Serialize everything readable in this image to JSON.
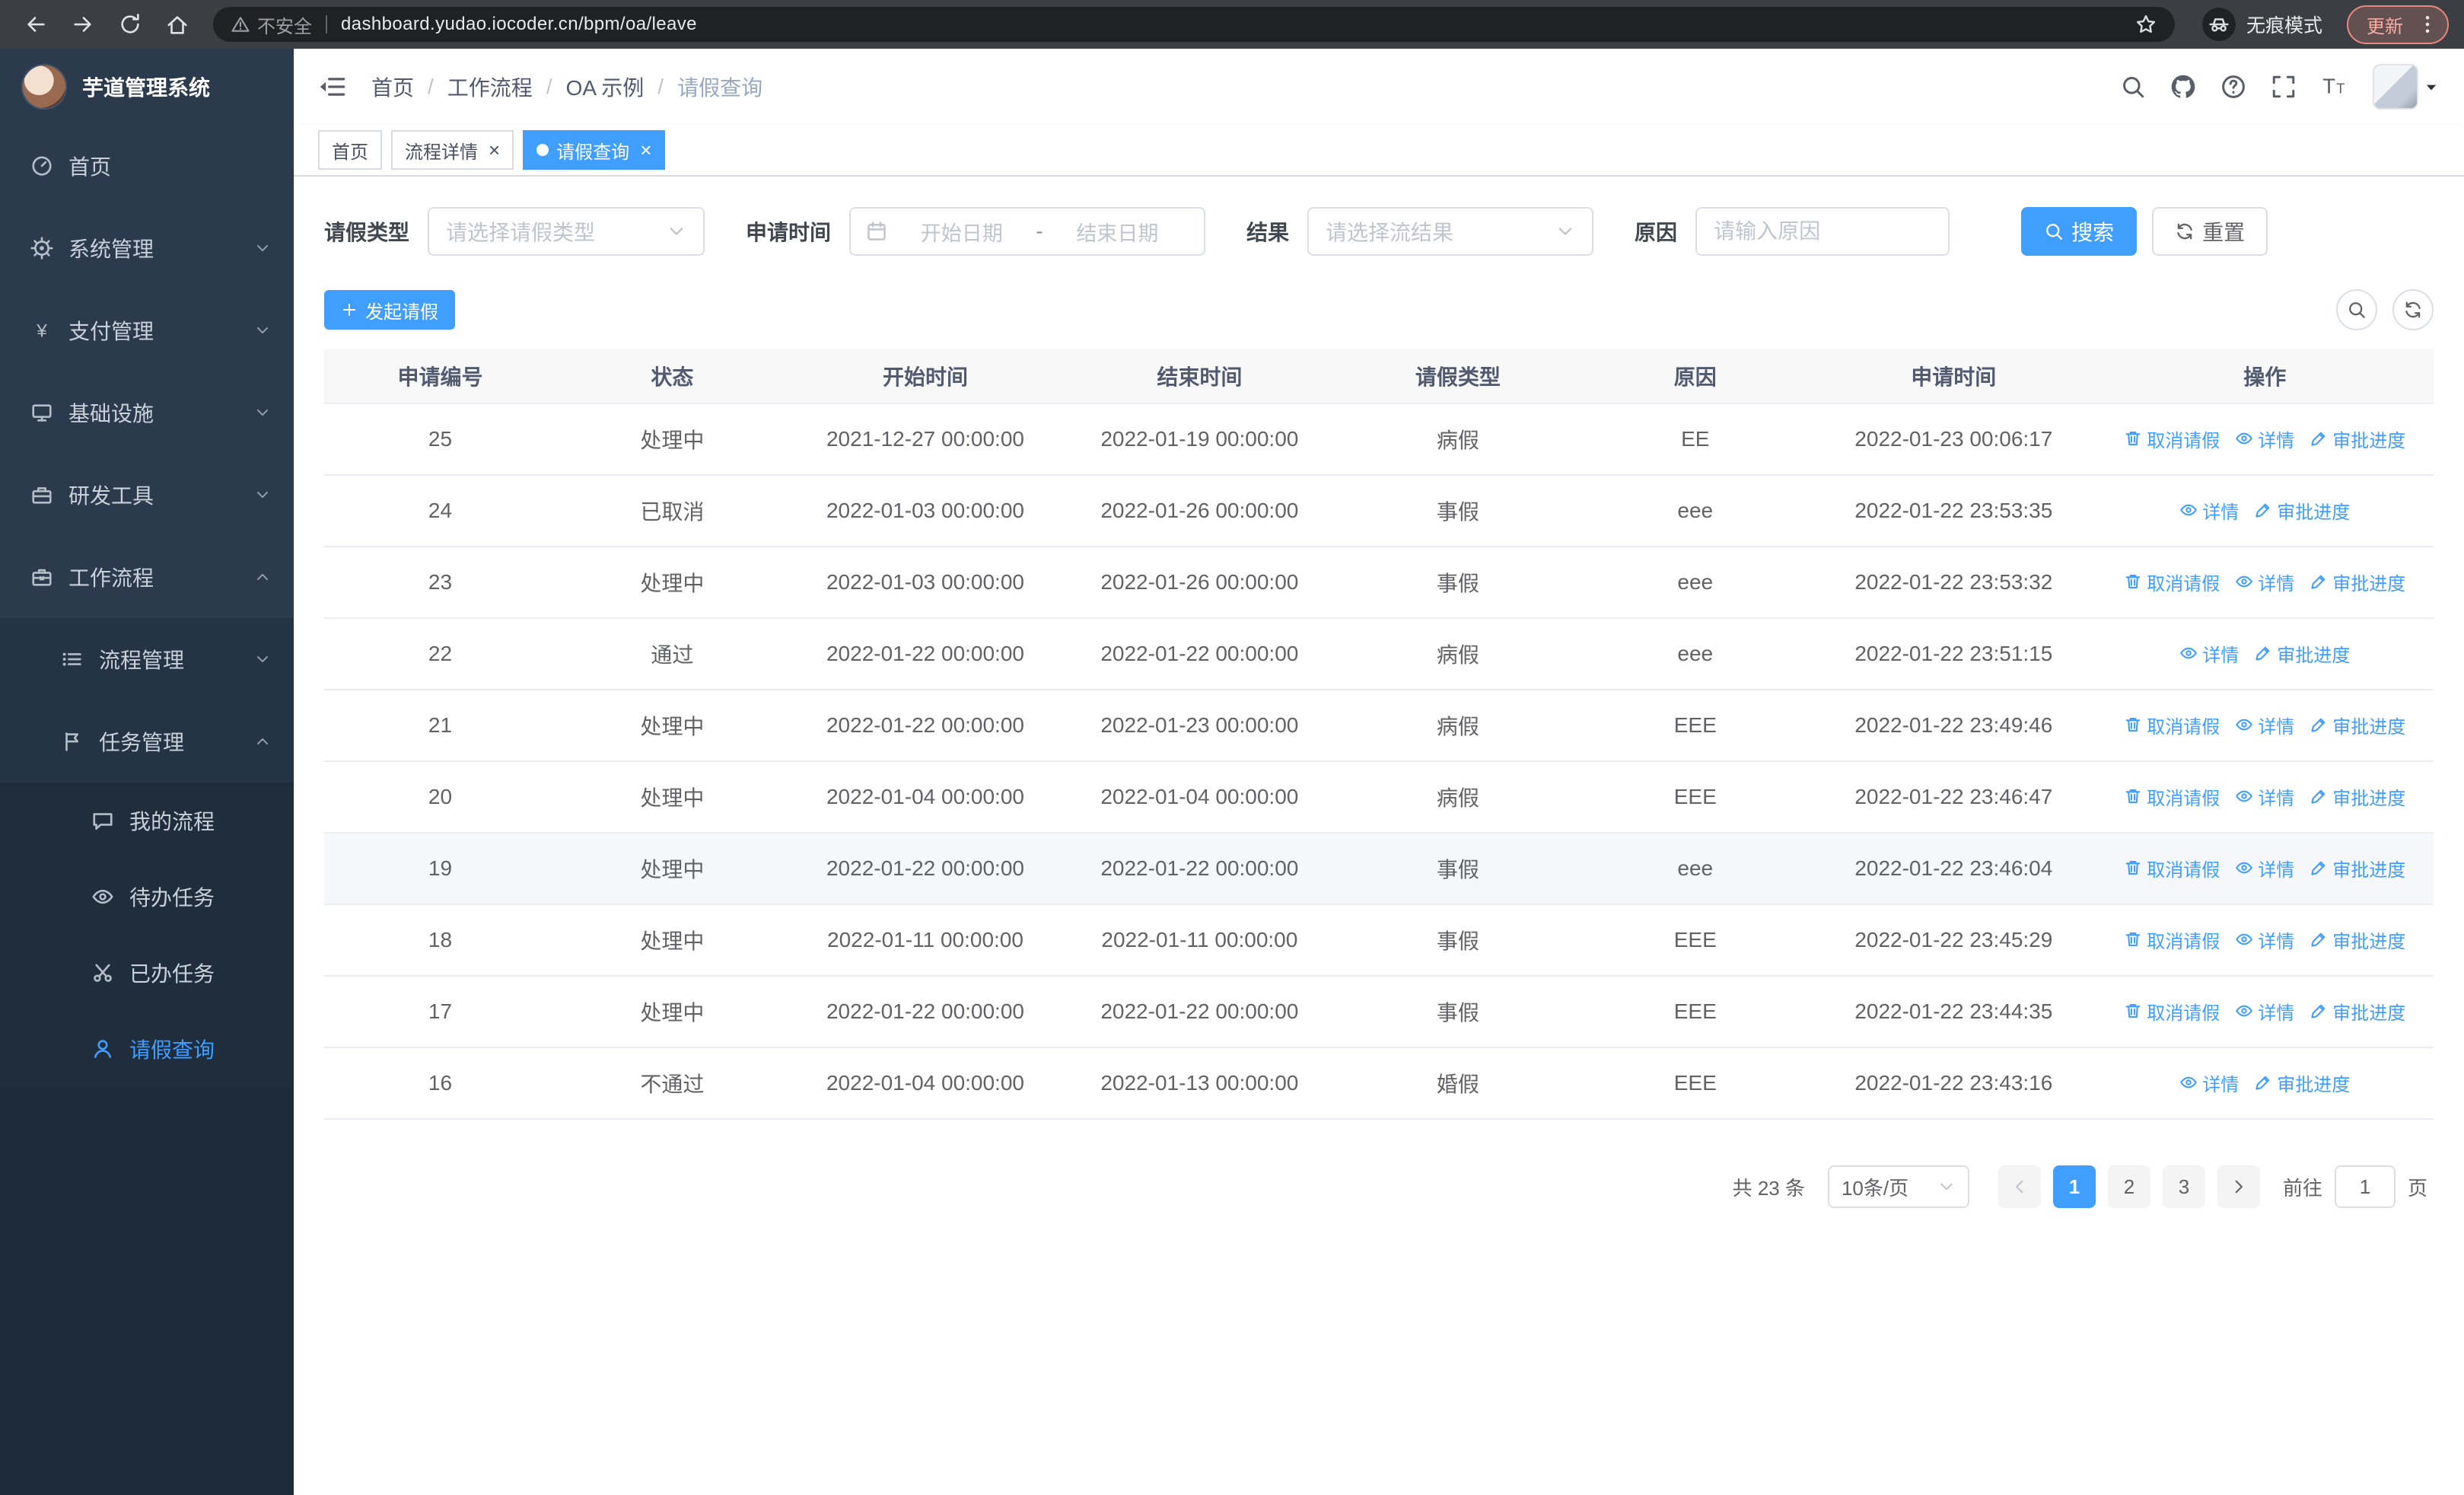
{
  "browser": {
    "security_warning": "不安全",
    "url": "dashboard.yudao.iocoder.cn/bpm/oa/leave",
    "incognito_label": "无痕模式",
    "update_label": "更新"
  },
  "sidebar": {
    "logo_title": "芋道管理系统",
    "items": [
      {
        "label": "首页",
        "icon": "dashboard",
        "level": 1
      },
      {
        "label": "系统管理",
        "icon": "gear",
        "level": 1,
        "chevron": "down"
      },
      {
        "label": "支付管理",
        "icon": "yen",
        "level": 1,
        "chevron": "down"
      },
      {
        "label": "基础设施",
        "icon": "monitor",
        "level": 1,
        "chevron": "down"
      },
      {
        "label": "研发工具",
        "icon": "toolbox",
        "level": 1,
        "chevron": "down"
      },
      {
        "label": "工作流程",
        "icon": "briefcase",
        "level": 1,
        "chevron": "up"
      },
      {
        "label": "流程管理",
        "icon": "list",
        "level": 2,
        "chevron": "down"
      },
      {
        "label": "任务管理",
        "icon": "flag",
        "level": 2,
        "chevron": "up"
      },
      {
        "label": "我的流程",
        "icon": "chat",
        "level": 3
      },
      {
        "label": "待办任务",
        "icon": "eye",
        "level": 3
      },
      {
        "label": "已办任务",
        "icon": "scissors",
        "level": 3
      },
      {
        "label": "请假查询",
        "icon": "user",
        "level": 3,
        "active": true
      }
    ]
  },
  "header": {
    "breadcrumb": [
      "首页",
      "工作流程",
      "OA 示例",
      "请假查询"
    ],
    "separator": "/"
  },
  "tabs": [
    {
      "label": "首页",
      "closable": false,
      "active": false
    },
    {
      "label": "流程详情",
      "closable": true,
      "active": false
    },
    {
      "label": "请假查询",
      "closable": true,
      "active": true
    }
  ],
  "filters": {
    "leave_type_label": "请假类型",
    "leave_type_placeholder": "请选择请假类型",
    "apply_time_label": "申请时间",
    "date_start_placeholder": "开始日期",
    "date_separator": "-",
    "date_end_placeholder": "结束日期",
    "result_label": "结果",
    "result_placeholder": "请选择流结果",
    "reason_label": "原因",
    "reason_placeholder": "请输入原因",
    "search_button": "搜索",
    "reset_button": "重置"
  },
  "toolbar": {
    "create_button": "发起请假"
  },
  "table": {
    "headers": [
      "申请编号",
      "状态",
      "开始时间",
      "结束时间",
      "请假类型",
      "原因",
      "申请时间",
      "操作"
    ],
    "action_labels": {
      "cancel": "取消请假",
      "detail": "详情",
      "progress": "审批进度"
    },
    "rows": [
      {
        "id": "25",
        "status": "处理中",
        "start": "2021-12-27 00:00:00",
        "end": "2022-01-19 00:00:00",
        "type": "病假",
        "reason": "EE",
        "applied": "2022-01-23 00:06:17",
        "actions": [
          "cancel",
          "detail",
          "progress"
        ]
      },
      {
        "id": "24",
        "status": "已取消",
        "start": "2022-01-03 00:00:00",
        "end": "2022-01-26 00:00:00",
        "type": "事假",
        "reason": "eee",
        "applied": "2022-01-22 23:53:35",
        "actions": [
          "detail",
          "progress"
        ]
      },
      {
        "id": "23",
        "status": "处理中",
        "start": "2022-01-03 00:00:00",
        "end": "2022-01-26 00:00:00",
        "type": "事假",
        "reason": "eee",
        "applied": "2022-01-22 23:53:32",
        "actions": [
          "cancel",
          "detail",
          "progress"
        ]
      },
      {
        "id": "22",
        "status": "通过",
        "start": "2022-01-22 00:00:00",
        "end": "2022-01-22 00:00:00",
        "type": "病假",
        "reason": "eee",
        "applied": "2022-01-22 23:51:15",
        "actions": [
          "detail",
          "progress"
        ]
      },
      {
        "id": "21",
        "status": "处理中",
        "start": "2022-01-22 00:00:00",
        "end": "2022-01-23 00:00:00",
        "type": "病假",
        "reason": "EEE",
        "applied": "2022-01-22 23:49:46",
        "actions": [
          "cancel",
          "detail",
          "progress"
        ]
      },
      {
        "id": "20",
        "status": "处理中",
        "start": "2022-01-04 00:00:00",
        "end": "2022-01-04 00:00:00",
        "type": "病假",
        "reason": "EEE",
        "applied": "2022-01-22 23:46:47",
        "actions": [
          "cancel",
          "detail",
          "progress"
        ]
      },
      {
        "id": "19",
        "status": "处理中",
        "start": "2022-01-22 00:00:00",
        "end": "2022-01-22 00:00:00",
        "type": "事假",
        "reason": "eee",
        "applied": "2022-01-22 23:46:04",
        "actions": [
          "cancel",
          "detail",
          "progress"
        ],
        "hover": true
      },
      {
        "id": "18",
        "status": "处理中",
        "start": "2022-01-11 00:00:00",
        "end": "2022-01-11 00:00:00",
        "type": "事假",
        "reason": "EEE",
        "applied": "2022-01-22 23:45:29",
        "actions": [
          "cancel",
          "detail",
          "progress"
        ]
      },
      {
        "id": "17",
        "status": "处理中",
        "start": "2022-01-22 00:00:00",
        "end": "2022-01-22 00:00:00",
        "type": "事假",
        "reason": "EEE",
        "applied": "2022-01-22 23:44:35",
        "actions": [
          "cancel",
          "detail",
          "progress"
        ]
      },
      {
        "id": "16",
        "status": "不通过",
        "start": "2022-01-04 00:00:00",
        "end": "2022-01-13 00:00:00",
        "type": "婚假",
        "reason": "EEE",
        "applied": "2022-01-22 23:43:16",
        "actions": [
          "detail",
          "progress"
        ]
      }
    ]
  },
  "pagination": {
    "total_text": "共 23 条",
    "page_size": "10条/页",
    "pages": [
      "1",
      "2",
      "3"
    ],
    "active_page": "1",
    "goto_label": "前往",
    "goto_value": "1",
    "goto_suffix": "页"
  },
  "colors": {
    "primary": "#409eff",
    "sidebar_bg": "#2c3a4d",
    "sidebar_sub_bg": "#1f2d3d",
    "table_header_bg": "#f8f8f9",
    "update_badge": "#f28b82"
  }
}
